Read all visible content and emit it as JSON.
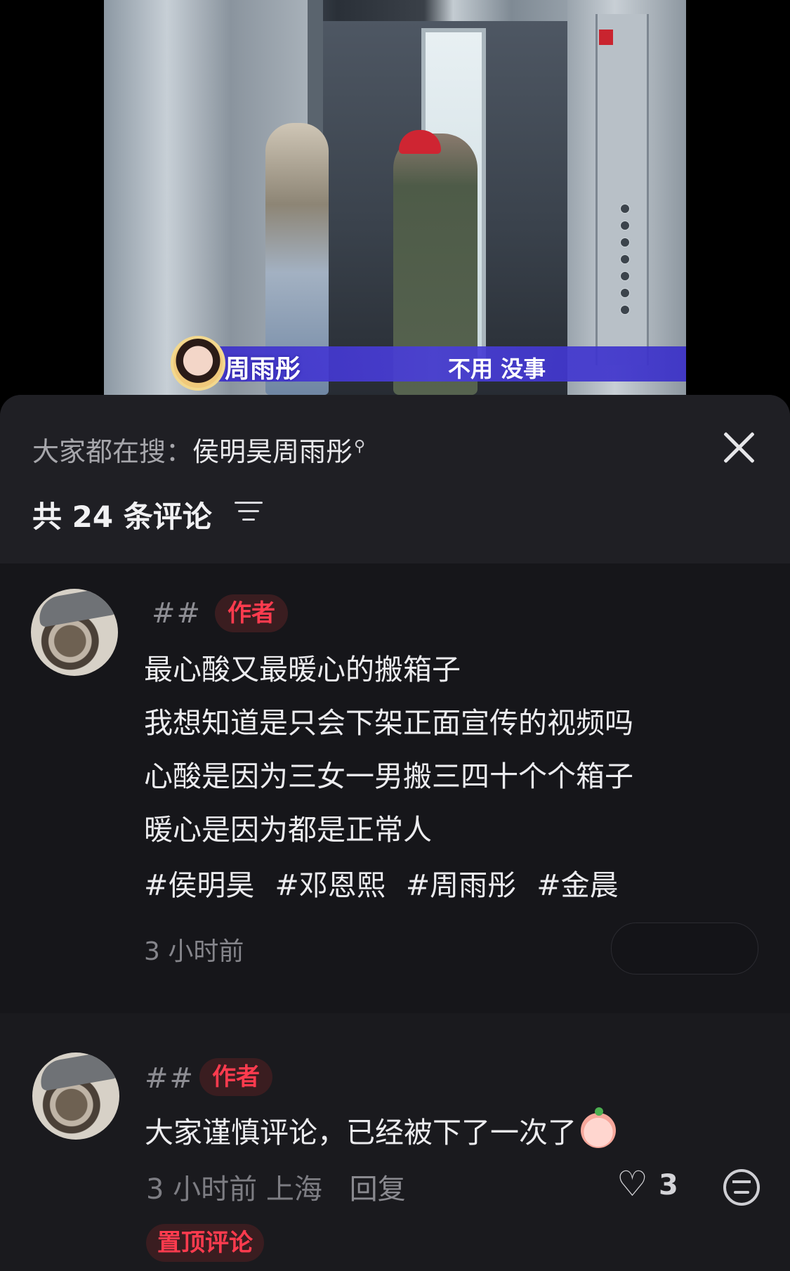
{
  "video": {
    "subtitle_name": "周雨彤",
    "subtitle_line": "不用 没事"
  },
  "header": {
    "search_prefix": "大家都在搜：",
    "search_keyword": "侯明昊周雨彤",
    "count_title": "共 24 条评论"
  },
  "comments": [
    {
      "author": "##",
      "tag": "作者",
      "lines": [
        "最心酸又最暖心的搬箱子",
        "我想知道是只会下架正面宣传的视频吗",
        "心酸是因为三女一男搬三四十个个箱子",
        "暖心是因为都是正常人"
      ],
      "hashtags": [
        "#侯明昊",
        "#邓恩熙",
        "#周雨彤",
        "#金晨"
      ],
      "time": "3 小时前"
    },
    {
      "author": "##",
      "tag": "作者",
      "text": "大家谨慎评论，已经被下了一次了",
      "time": "3 小时前",
      "location": "上海",
      "reply_label": "回复",
      "likes": "3",
      "pinned_label": "置顶评论"
    }
  ],
  "icons": [
    "search-icon",
    "close-icon",
    "sort-icon",
    "heart-icon",
    "emoji-icon"
  ]
}
